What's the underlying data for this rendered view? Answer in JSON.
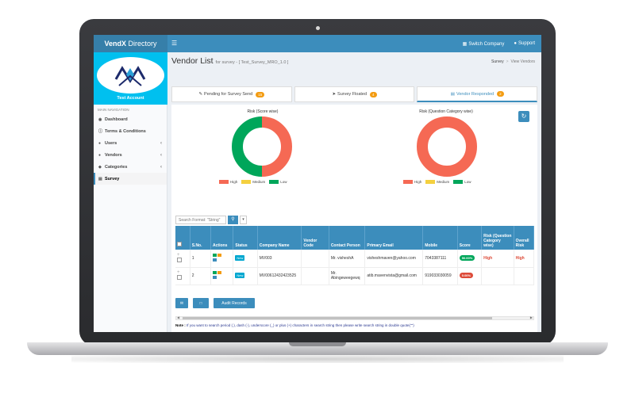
{
  "topbar": {
    "brand_bold": "VendX",
    "brand_rest": " Directory",
    "switch_company": "Switch Company",
    "support": "Support"
  },
  "sidebar": {
    "account": "Test Account",
    "nav_header": "MAIN NAVIGATION",
    "items": [
      {
        "label": "Dashboard",
        "icon": "dashboard-icon"
      },
      {
        "label": "Terms & Conditions",
        "icon": "info-icon"
      },
      {
        "label": "Users",
        "icon": "user-icon"
      },
      {
        "label": "Vendors",
        "icon": "users-icon"
      },
      {
        "label": "Categories",
        "icon": "tag-icon"
      },
      {
        "label": "Survey",
        "icon": "survey-icon"
      }
    ]
  },
  "page": {
    "title": "Vendor List",
    "subtitle": "for survey - [ Test_Survey_MRO_1.0 ]",
    "breadcrumb_1": "Survey",
    "breadcrumb_2": "View Vendors"
  },
  "tabs": [
    {
      "label": "Pending for Survey Send",
      "count": "15",
      "badge_color": "#f39c12"
    },
    {
      "label": "Survey Floated",
      "count": "4",
      "badge_color": "#f39c12"
    },
    {
      "label": "Vendor Responded",
      "count": "2",
      "badge_color": "#f39c12"
    }
  ],
  "chart_data": [
    {
      "type": "pie",
      "title": "Risk (Score wise)",
      "categories": [
        "High",
        "Medium",
        "Low"
      ],
      "values": [
        1,
        0,
        1
      ],
      "colors": [
        "#f56954",
        "#f4d03f",
        "#00a65a"
      ],
      "legend": "bottom"
    },
    {
      "type": "pie",
      "title": "Risk (Question Category wise)",
      "categories": [
        "High",
        "Medium",
        "Low"
      ],
      "values": [
        2,
        0,
        0
      ],
      "colors": [
        "#f56954",
        "#f4d03f",
        "#00a65a"
      ],
      "legend": "bottom"
    }
  ],
  "search": {
    "placeholder": "Search Format: \"String\""
  },
  "table": {
    "headers": [
      "S.No.",
      "Actions",
      "Status",
      "Company Name",
      "Vendor Code",
      "Contact Person",
      "Primary Email",
      "Mobile",
      "Score",
      "Risk (Question Category wise)",
      "Overall Risk"
    ],
    "rows": [
      {
        "sno": "1",
        "status": "New",
        "company": "MV003",
        "vendor_code": "",
        "contact": "Mr. visheshA",
        "email": "visheshmaven@yahoo.com",
        "mobile": "7043387111",
        "score": "50.00%",
        "score_color": "#00a65a",
        "risk_cat": "High",
        "overall": "High"
      },
      {
        "sno": "2",
        "status": "New",
        "company": "MV00612432423525",
        "vendor_code": "",
        "contact": "Mr. Abingeweegewq",
        "email": "atib.mavenvista@gmail.com",
        "mobile": "919033030059",
        "score": "0.00%",
        "score_color": "#dd4b39",
        "risk_cat": "",
        "overall": ""
      }
    ]
  },
  "footer": {
    "audit_button": "Audit Records",
    "note_label": "Note :",
    "note_text": " If you want to search period (.), dash (-), underscore (_) or plus (+) characters in search string then please write search string in double quote(\"\")"
  }
}
